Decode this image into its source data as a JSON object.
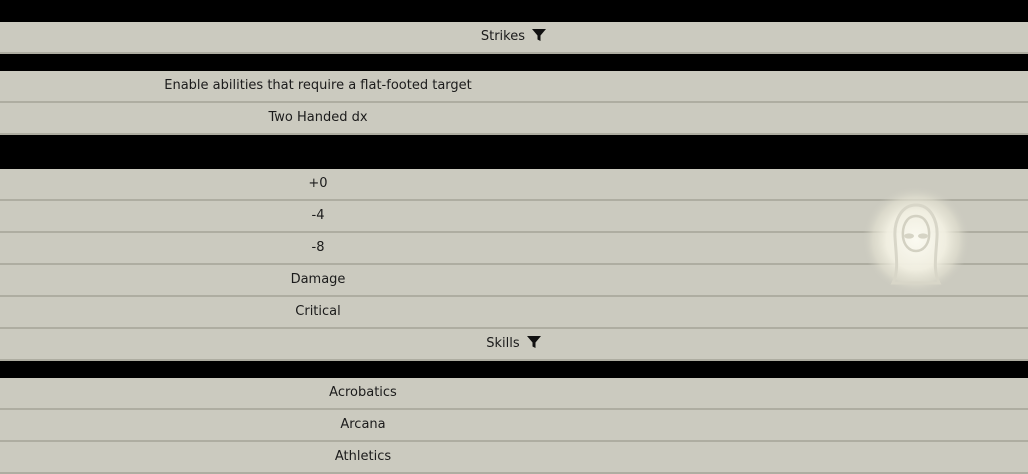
{
  "strikes": {
    "header_label": "Strikes",
    "options": [
      "Enable abilities that require a flat-footed target",
      "Two Handed dx"
    ],
    "attack_rows": [
      "+0",
      "-4",
      "-8",
      "Damage",
      "Critical"
    ]
  },
  "skills": {
    "header_label": "Skills",
    "rows": [
      "Acrobatics",
      "Arcana",
      "Athletics"
    ]
  },
  "icons": {
    "filter": "filter-icon",
    "token": "hooded-figure-icon"
  },
  "colors": {
    "row_background": "#cbcabf",
    "band": "#000000",
    "row_divider": "#aeada1"
  }
}
